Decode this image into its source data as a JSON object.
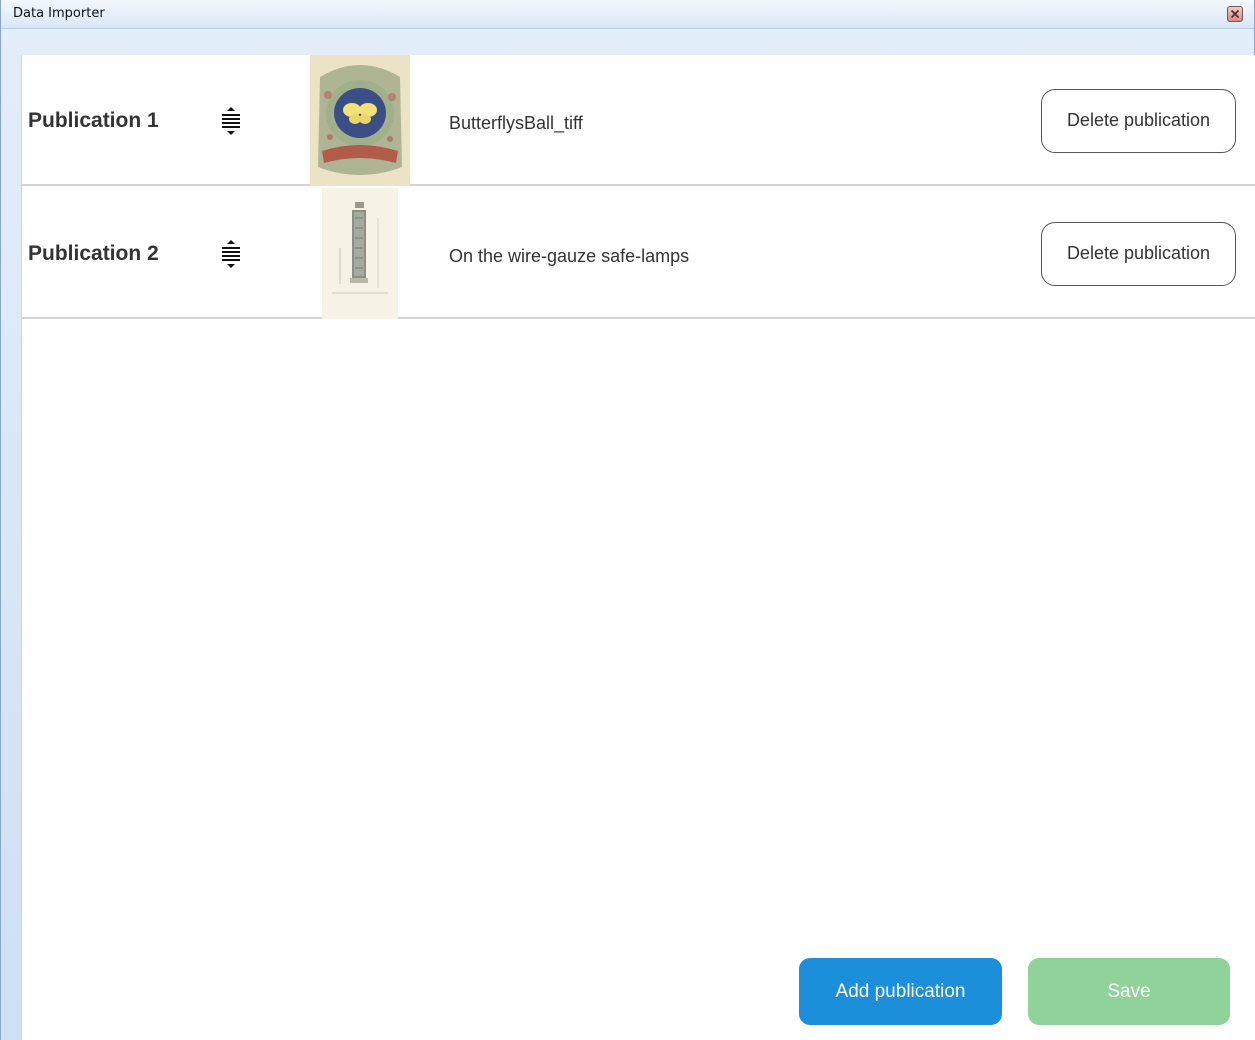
{
  "window": {
    "title": "Data Importer"
  },
  "publications": [
    {
      "label": "Publication 1",
      "name": "ButterflysBall_tiff",
      "delete_label": "Delete publication",
      "thumbnail_icon": "butterfly-cover-thumbnail"
    },
    {
      "label": "Publication 2",
      "name": "On the wire-gauze safe-lamps",
      "delete_label": "Delete publication",
      "thumbnail_icon": "safe-lamp-diagram-thumbnail"
    }
  ],
  "footer": {
    "add_label": "Add publication",
    "save_label": "Save"
  },
  "colors": {
    "add_button": "#1b8fd9",
    "save_button": "#8fd29a",
    "title_bar": "#dbe8f6"
  }
}
